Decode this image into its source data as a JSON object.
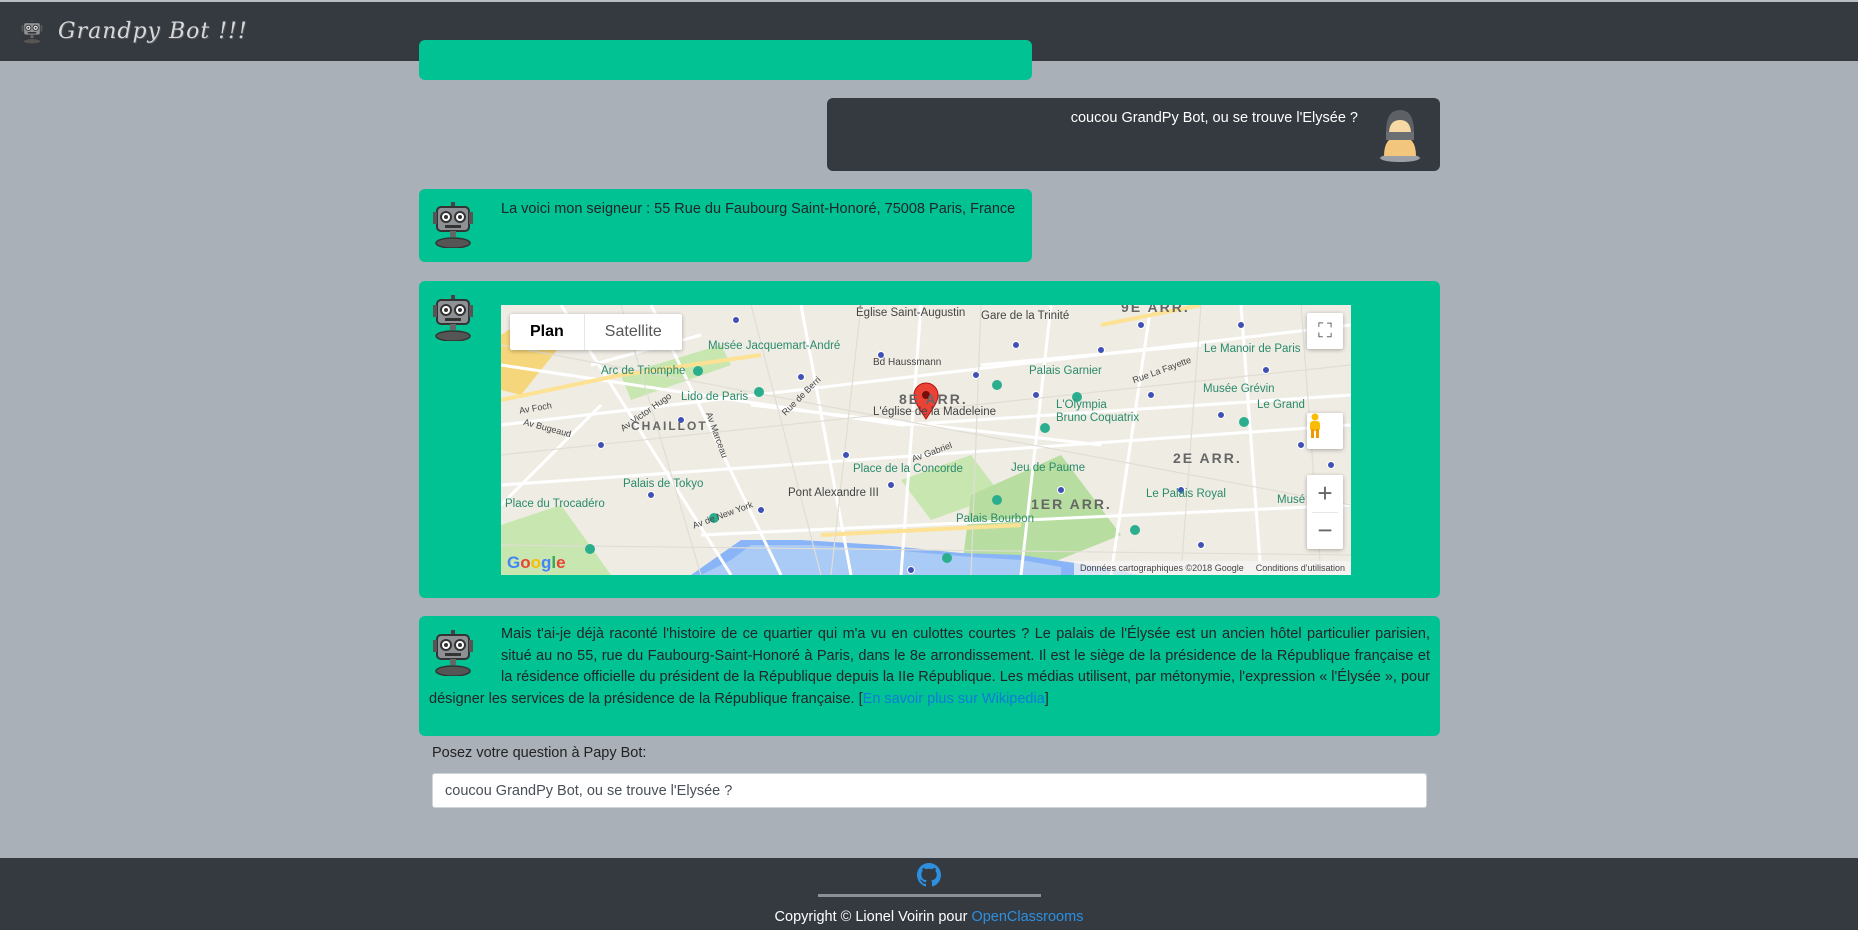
{
  "app": {
    "title": "Grandpy Bot !!!"
  },
  "chat": {
    "user_question": "coucou GrandPy Bot, ou se trouve l'Elysée ?",
    "bot_address": "La voici mon seigneur : 55 Rue du Faubourg Saint-Honoré, 75008 Paris, France",
    "bot_story": "Mais t'ai-je déjà raconté l'histoire de ce quartier qui m'a vu en culottes courtes ? Le palais de l'Élysée est un ancien hôtel particulier parisien, situé au no 55, rue du Faubourg-Saint-Honoré à Paris, dans le 8e arrondissement. Il est le siège de la présidence de la République française et la résidence officielle du président de la République depuis la IIe République. Les médias utilisent, par métonymie, l'expression « l'Élysée », pour désigner les services de la présidence de la République française.",
    "story_link_open": " [",
    "story_link": "En savoir plus sur Wikipedia",
    "story_link_close": "]"
  },
  "map": {
    "type_plan": "Plan",
    "type_satellite": "Satellite",
    "zoom_in": "+",
    "zoom_out": "−",
    "fullscreen": "⛶",
    "attribution": "Données cartographiques ©2018 Google",
    "terms": "Conditions d'utilisation",
    "google": [
      "G",
      "o",
      "o",
      "g",
      "l",
      "e"
    ],
    "labels": {
      "eglise_augustin": "Église Saint-Augustin",
      "gare_trinite": "Gare de la Trinité",
      "musee_jacquemart": "Musée Jacquemart-André",
      "bd_haussmann": "Bd Haussmann",
      "arc": "Arc de Triomphe",
      "lido": "Lido de Paris",
      "av_foch": "Av Foch",
      "palais_garnier": "Palais Garnier",
      "manoir": "Le Manoir de Paris",
      "musee_grevin": "Musée Grévin",
      "le_grand": "Le Grand",
      "olympia": "L'Olympia",
      "olympia2": "Bruno Coquatrix",
      "8e": "8E ARR.",
      "madeleine": "L'église de la Madeleine",
      "chaillot": "CHAILLOT",
      "2e": "2E ARR.",
      "9e": "9E ARR.",
      "concorde": "Place de la Concorde",
      "jeu_paume": "Jeu de Paume",
      "palais_tokyo": "Palais de Tokyo",
      "pont_alex": "Pont Alexandre III",
      "1er": "1ER ARR.",
      "palais_royal": "Le Palais Royal",
      "trocadero": "Place du Trocadéro",
      "palais_bourbon": "Palais Bourbon",
      "av_victor_hugo": "Av Victor Hugo",
      "av_bugeaud": "Av Bugeaud",
      "av_marceau": "Av Marceau",
      "av_gabriel": "Av Gabriel",
      "av_new_york": "Av de New York",
      "rue_berri": "Rue de Berri",
      "rue_lafayette": "Rue La Fayette",
      "musee": "Musé"
    }
  },
  "form": {
    "label": "Posez votre question à Papy Bot:",
    "input_value": "coucou GrandPy Bot, ou se trouve l'Elysée ?"
  },
  "footer": {
    "copyright": "Copyright © Lionel Voirin pour ",
    "link": "OpenClassrooms"
  },
  "colors": {
    "bot_bubble": "#01c293",
    "user_bubble": "#343a40",
    "background": "#a9b0b8",
    "nav": "#343a40",
    "link": "#0d7bd8"
  }
}
